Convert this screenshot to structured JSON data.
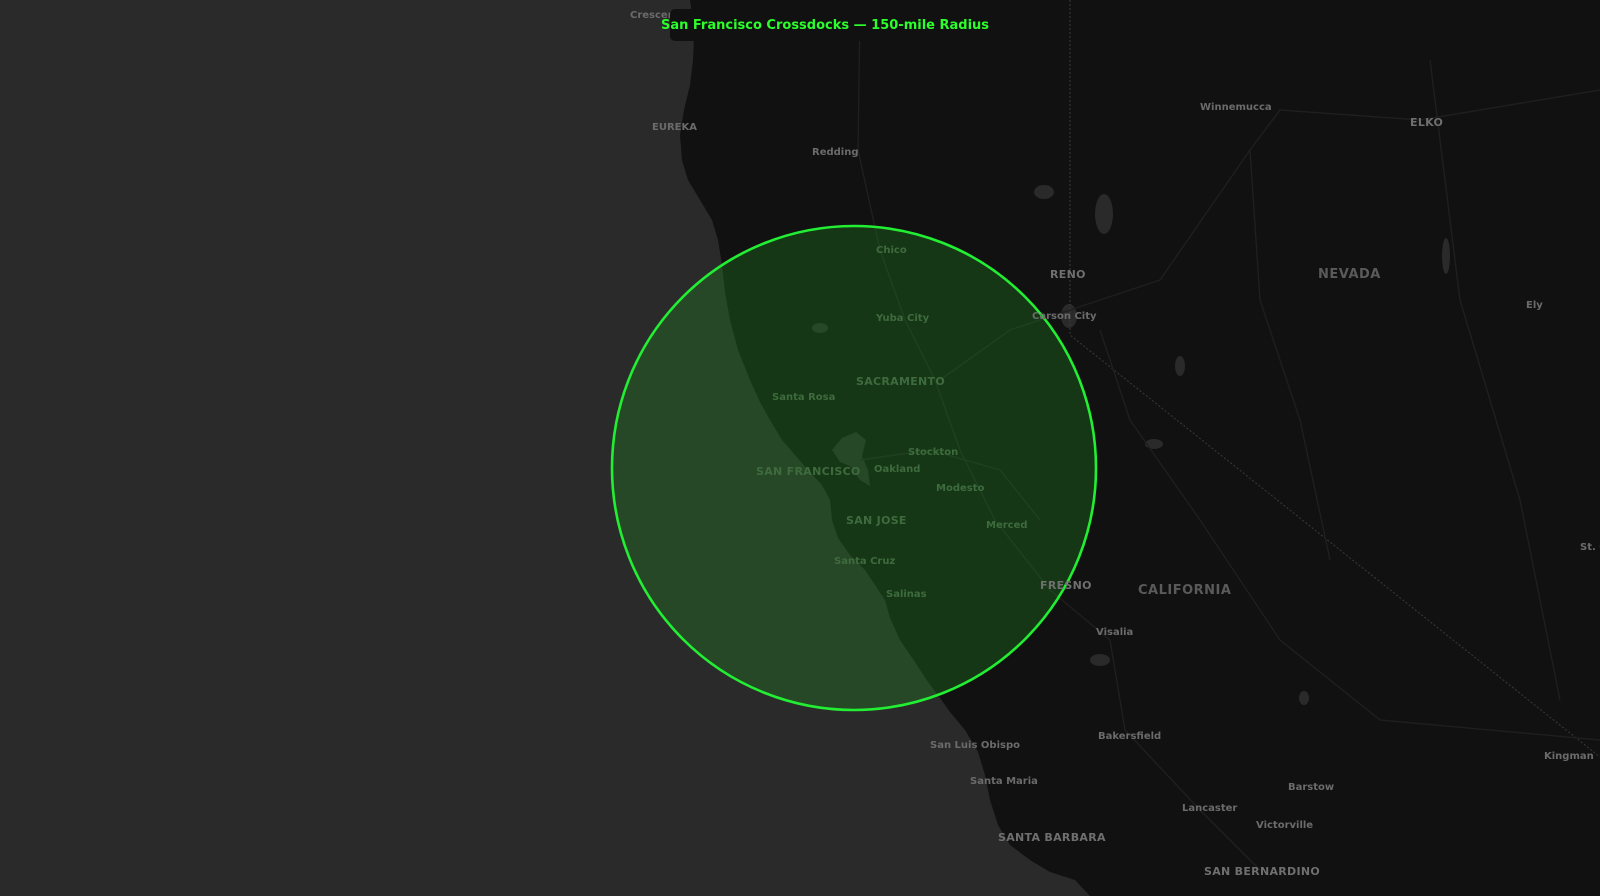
{
  "map": {
    "title": "San Francisco Crossdocks — 150-mile Radius",
    "radius": {
      "center_city": "SAN FRANCISCO",
      "radius_miles": 150,
      "stroke_color": "#22ee33",
      "fill_color": "#1a5c1a"
    },
    "colors": {
      "ocean": "#2a2a2a",
      "land": "#111111",
      "accent": "#2bff2b"
    },
    "labels": {
      "crescent": "Crescent",
      "eureka": "EUREKA",
      "redding": "Redding",
      "chico": "Chico",
      "yuba_city": "Yuba City",
      "sacramento": "SACRAMENTO",
      "santa_rosa": "Santa Rosa",
      "stockton": "Stockton",
      "san_francisco": "SAN FRANCISCO",
      "oakland": "Oakland",
      "modesto": "Modesto",
      "san_jose": "SAN JOSE",
      "merced": "Merced",
      "santa_cruz": "Santa Cruz",
      "salinas": "Salinas",
      "fresno": "FRESNO",
      "california": "CALIFORNIA",
      "visalia": "Visalia",
      "bakersfield": "Bakersfield",
      "san_luis_obispo": "San Luis Obispo",
      "santa_maria": "Santa Maria",
      "lancaster": "Lancaster",
      "barstow": "Barstow",
      "victorville": "Victorville",
      "santa_barbara": "SANTA BARBARA",
      "san_bernardino": "SAN BERNARDINO",
      "kingman": "Kingman",
      "reno": "RENO",
      "carson_city": "Carson City",
      "winnemucca": "Winnemucca",
      "elko": "ELKO",
      "nevada": "NEVADA",
      "ely": "Ely",
      "st_george": "St. G"
    }
  }
}
